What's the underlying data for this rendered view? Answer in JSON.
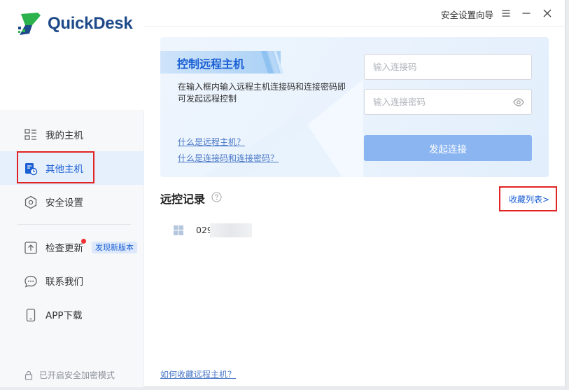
{
  "app": {
    "name": "QuickDesk"
  },
  "titlebar": {
    "wizard": "安全设置向导"
  },
  "sidebar": {
    "items": [
      {
        "label": "我的主机"
      },
      {
        "label": "其他主机"
      },
      {
        "label": "安全设置"
      },
      {
        "label": "检查更新",
        "badge": "发现新版本"
      },
      {
        "label": "联系我们"
      },
      {
        "label": "APP下载"
      }
    ],
    "footer": "已开启安全加密模式"
  },
  "connect": {
    "title": "控制远程主机",
    "desc": "在输入框内输入远程主机连接码和连接密码即可发起远程控制",
    "code_placeholder": "输入连接码",
    "password_placeholder": "输入连接密码",
    "button": "发起连接",
    "link_what_host": "什么是远程主机？",
    "link_what_code": "什么是连接码和连接密码？"
  },
  "history": {
    "title": "远控记录",
    "favorites_link": "收藏列表>",
    "items": [
      {
        "id": "029"
      }
    ]
  },
  "bottom_link": "如何收藏远程主机？",
  "colors": {
    "accent": "#1a5fd4",
    "highlight": "#e02424",
    "button": "#8ab5f1"
  }
}
